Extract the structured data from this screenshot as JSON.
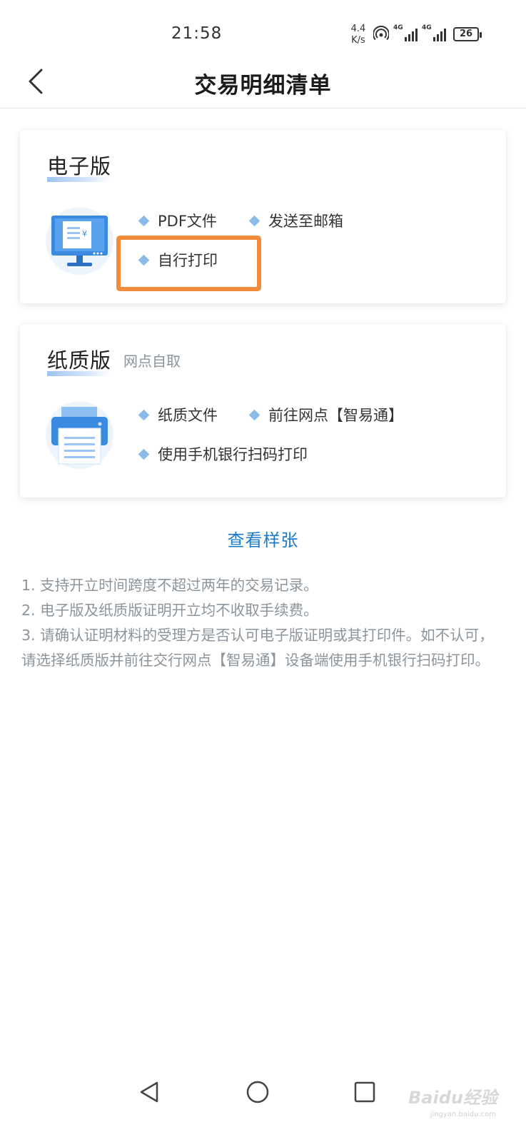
{
  "status_bar": {
    "time": "21:58",
    "net_speed": "4.4",
    "net_unit": "K/s",
    "sim1_tag": "4G",
    "sim2_tag": "4G",
    "battery": "26"
  },
  "header": {
    "title": "交易明细清单"
  },
  "electronic": {
    "title": "电子版",
    "options": [
      "PDF文件",
      "发送至邮箱",
      "自行打印"
    ]
  },
  "paper": {
    "title": "纸质版",
    "subtitle": "网点自取",
    "options": [
      "纸质文件",
      "前往网点【智易通】",
      "使用手机银行扫码打印"
    ]
  },
  "sample_link": "查看样张",
  "notes": [
    "1. 支持开立时间跨度不超过两年的交易记录。",
    "2. 电子版及纸质版证明开立均不收取手续费。",
    "3. 请确认证明材料的受理方是否认可电子版证明或其打印件。如不认可，请选择纸质版并前往交行网点【智易通】设备端使用手机银行扫码打印。"
  ],
  "watermark": {
    "text": "Baidu经验",
    "sub": "jingyan.baidu.com"
  },
  "colors": {
    "accent_blue": "#1d7ac9",
    "highlight_orange": "#ef8c3d",
    "diamond_blue": "#8bbbea"
  }
}
